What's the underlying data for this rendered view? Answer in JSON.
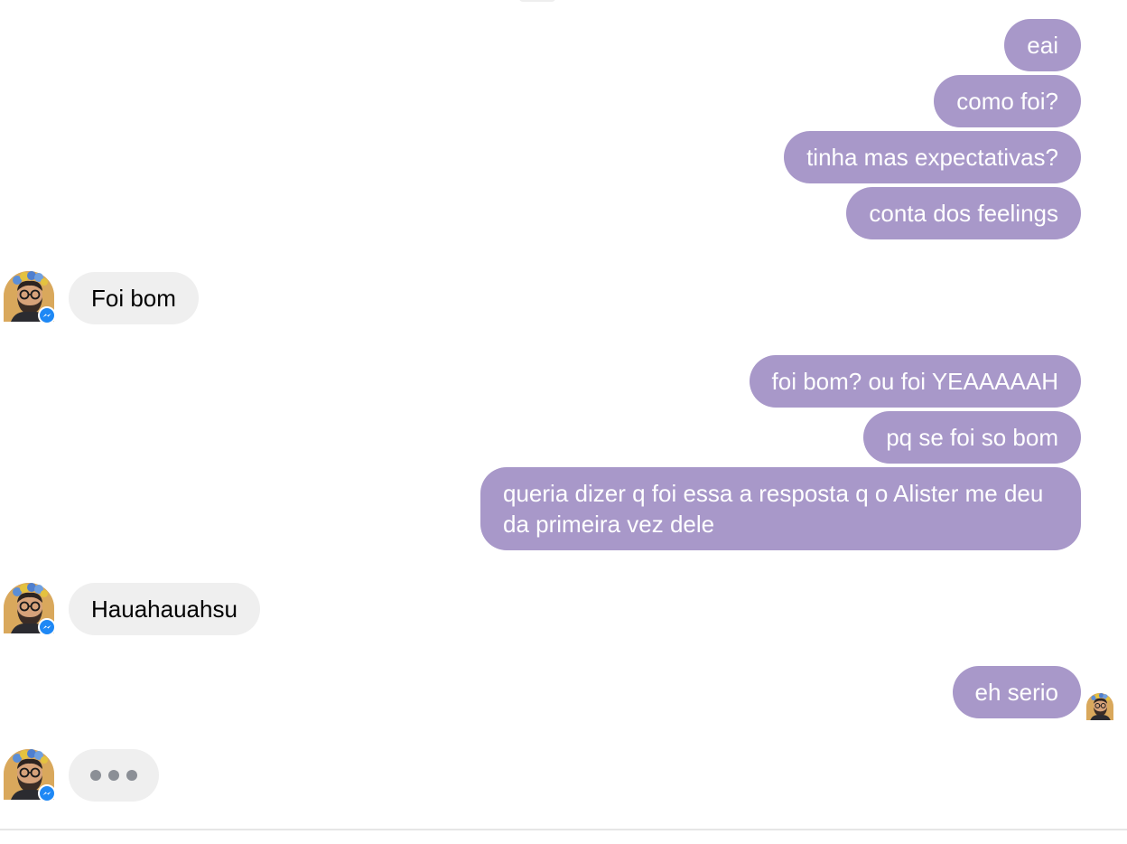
{
  "conversation": {
    "outgoing_group_1": [
      "eai",
      "como foi?",
      "tinha mas expectativas?",
      "conta dos feelings"
    ],
    "incoming_1": "Foi bom",
    "outgoing_group_2": [
      "foi bom? ou foi YEAAAAAH",
      "pq se foi so bom",
      "queria dizer q foi essa a resposta q o Alister me deu da primeira vez dele"
    ],
    "incoming_2": "Hauahauahsu",
    "outgoing_3": "eh serio"
  },
  "theme": {
    "outgoing_bubble_color": "#a898c9",
    "incoming_bubble_color": "#efefef",
    "messenger_badge_color": "#1e88f5"
  },
  "icons": {
    "contact_avatar": "bearded-man-glasses-avatar",
    "badge": "messenger-icon",
    "seen_indicator": "seen-avatar-icon",
    "typing": "typing-dots-icon"
  }
}
